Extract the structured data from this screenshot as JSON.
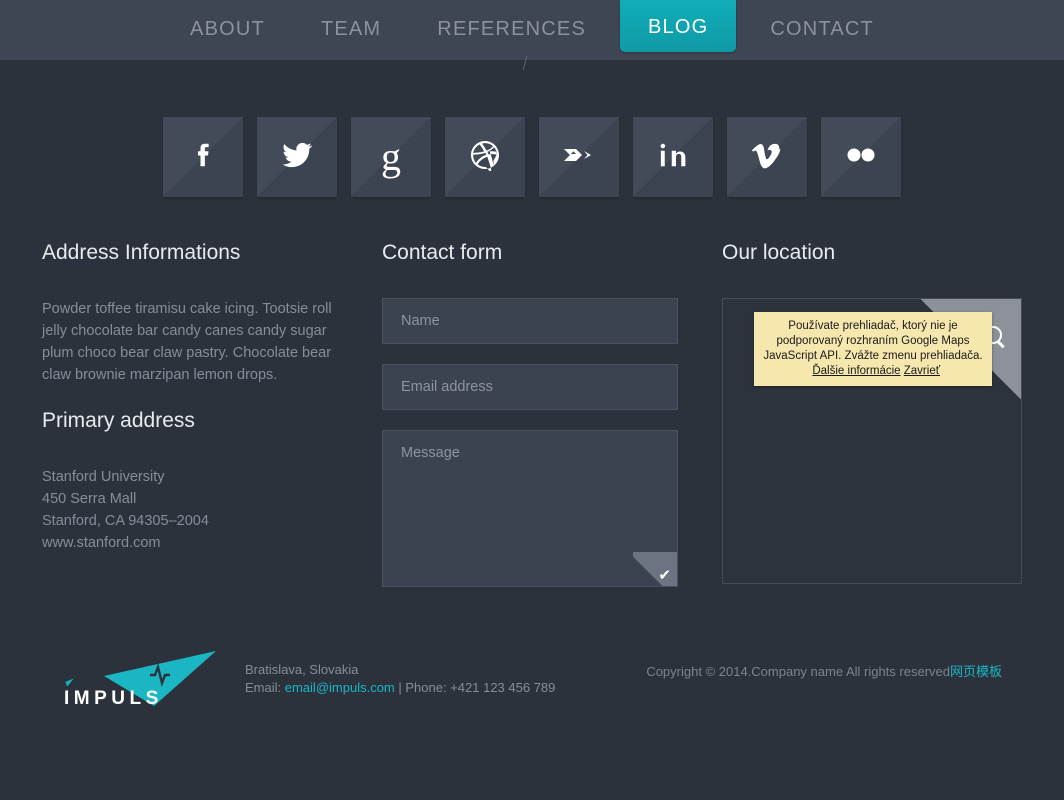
{
  "nav": {
    "items": [
      {
        "label": "ABOUT",
        "active": false
      },
      {
        "label": "TEAM",
        "active": false
      },
      {
        "label": "REFERENCES",
        "active": false
      },
      {
        "label": "BLOG",
        "active": true
      },
      {
        "label": "CONTACT",
        "active": false
      }
    ],
    "active_color": "#10adb8"
  },
  "social": {
    "items": [
      {
        "name": "facebook-icon",
        "label": "Facebook"
      },
      {
        "name": "twitter-icon",
        "label": "Twitter"
      },
      {
        "name": "google-plus-icon",
        "label": "Google Plus"
      },
      {
        "name": "dribbble-icon",
        "label": "Dribbble"
      },
      {
        "name": "behance-icon",
        "label": "Behance"
      },
      {
        "name": "linkedin-icon",
        "label": "LinkedIn"
      },
      {
        "name": "vimeo-icon",
        "label": "Vimeo"
      },
      {
        "name": "flickr-icon",
        "label": "Flickr"
      }
    ]
  },
  "address": {
    "title": "Address Informations",
    "paragraph": "Powder toffee tiramisu cake icing. Tootsie roll jelly chocolate bar candy canes candy sugar plum choco bear claw pastry. Chocolate bear claw brownie marzipan lemon drops.",
    "primary_title": "Primary address",
    "lines": [
      "Stanford University",
      "450 Serra Mall",
      "Stanford, CA 94305–2004",
      "www.stanford.com"
    ]
  },
  "form": {
    "title": "Contact form",
    "name_placeholder": "Name",
    "name_value": "",
    "email_placeholder": "Email address",
    "email_value": "",
    "message_placeholder": "Message",
    "message_value": "",
    "submit_icon": "✔"
  },
  "map": {
    "title": "Our location",
    "search_icon": "search-icon",
    "warning": {
      "text": "Používate prehliadač, ktorý nie je podporovaný rozhraním Google Maps JavaScript API. Zvážte zmenu prehliadača.",
      "more_link": "Ďalšie informácie",
      "close_link": "Zavrieť"
    }
  },
  "footer": {
    "logo_text": "IMPULS",
    "location": "Bratislava, Slovakia",
    "email_label": "Email:",
    "email": "email@impuls.com",
    "phone_sep": "| Phone:",
    "phone": "+421 123 456 789",
    "copyright": "Copyright © 2014.Company name All rights reserved",
    "copyright_link": "网页模板"
  }
}
